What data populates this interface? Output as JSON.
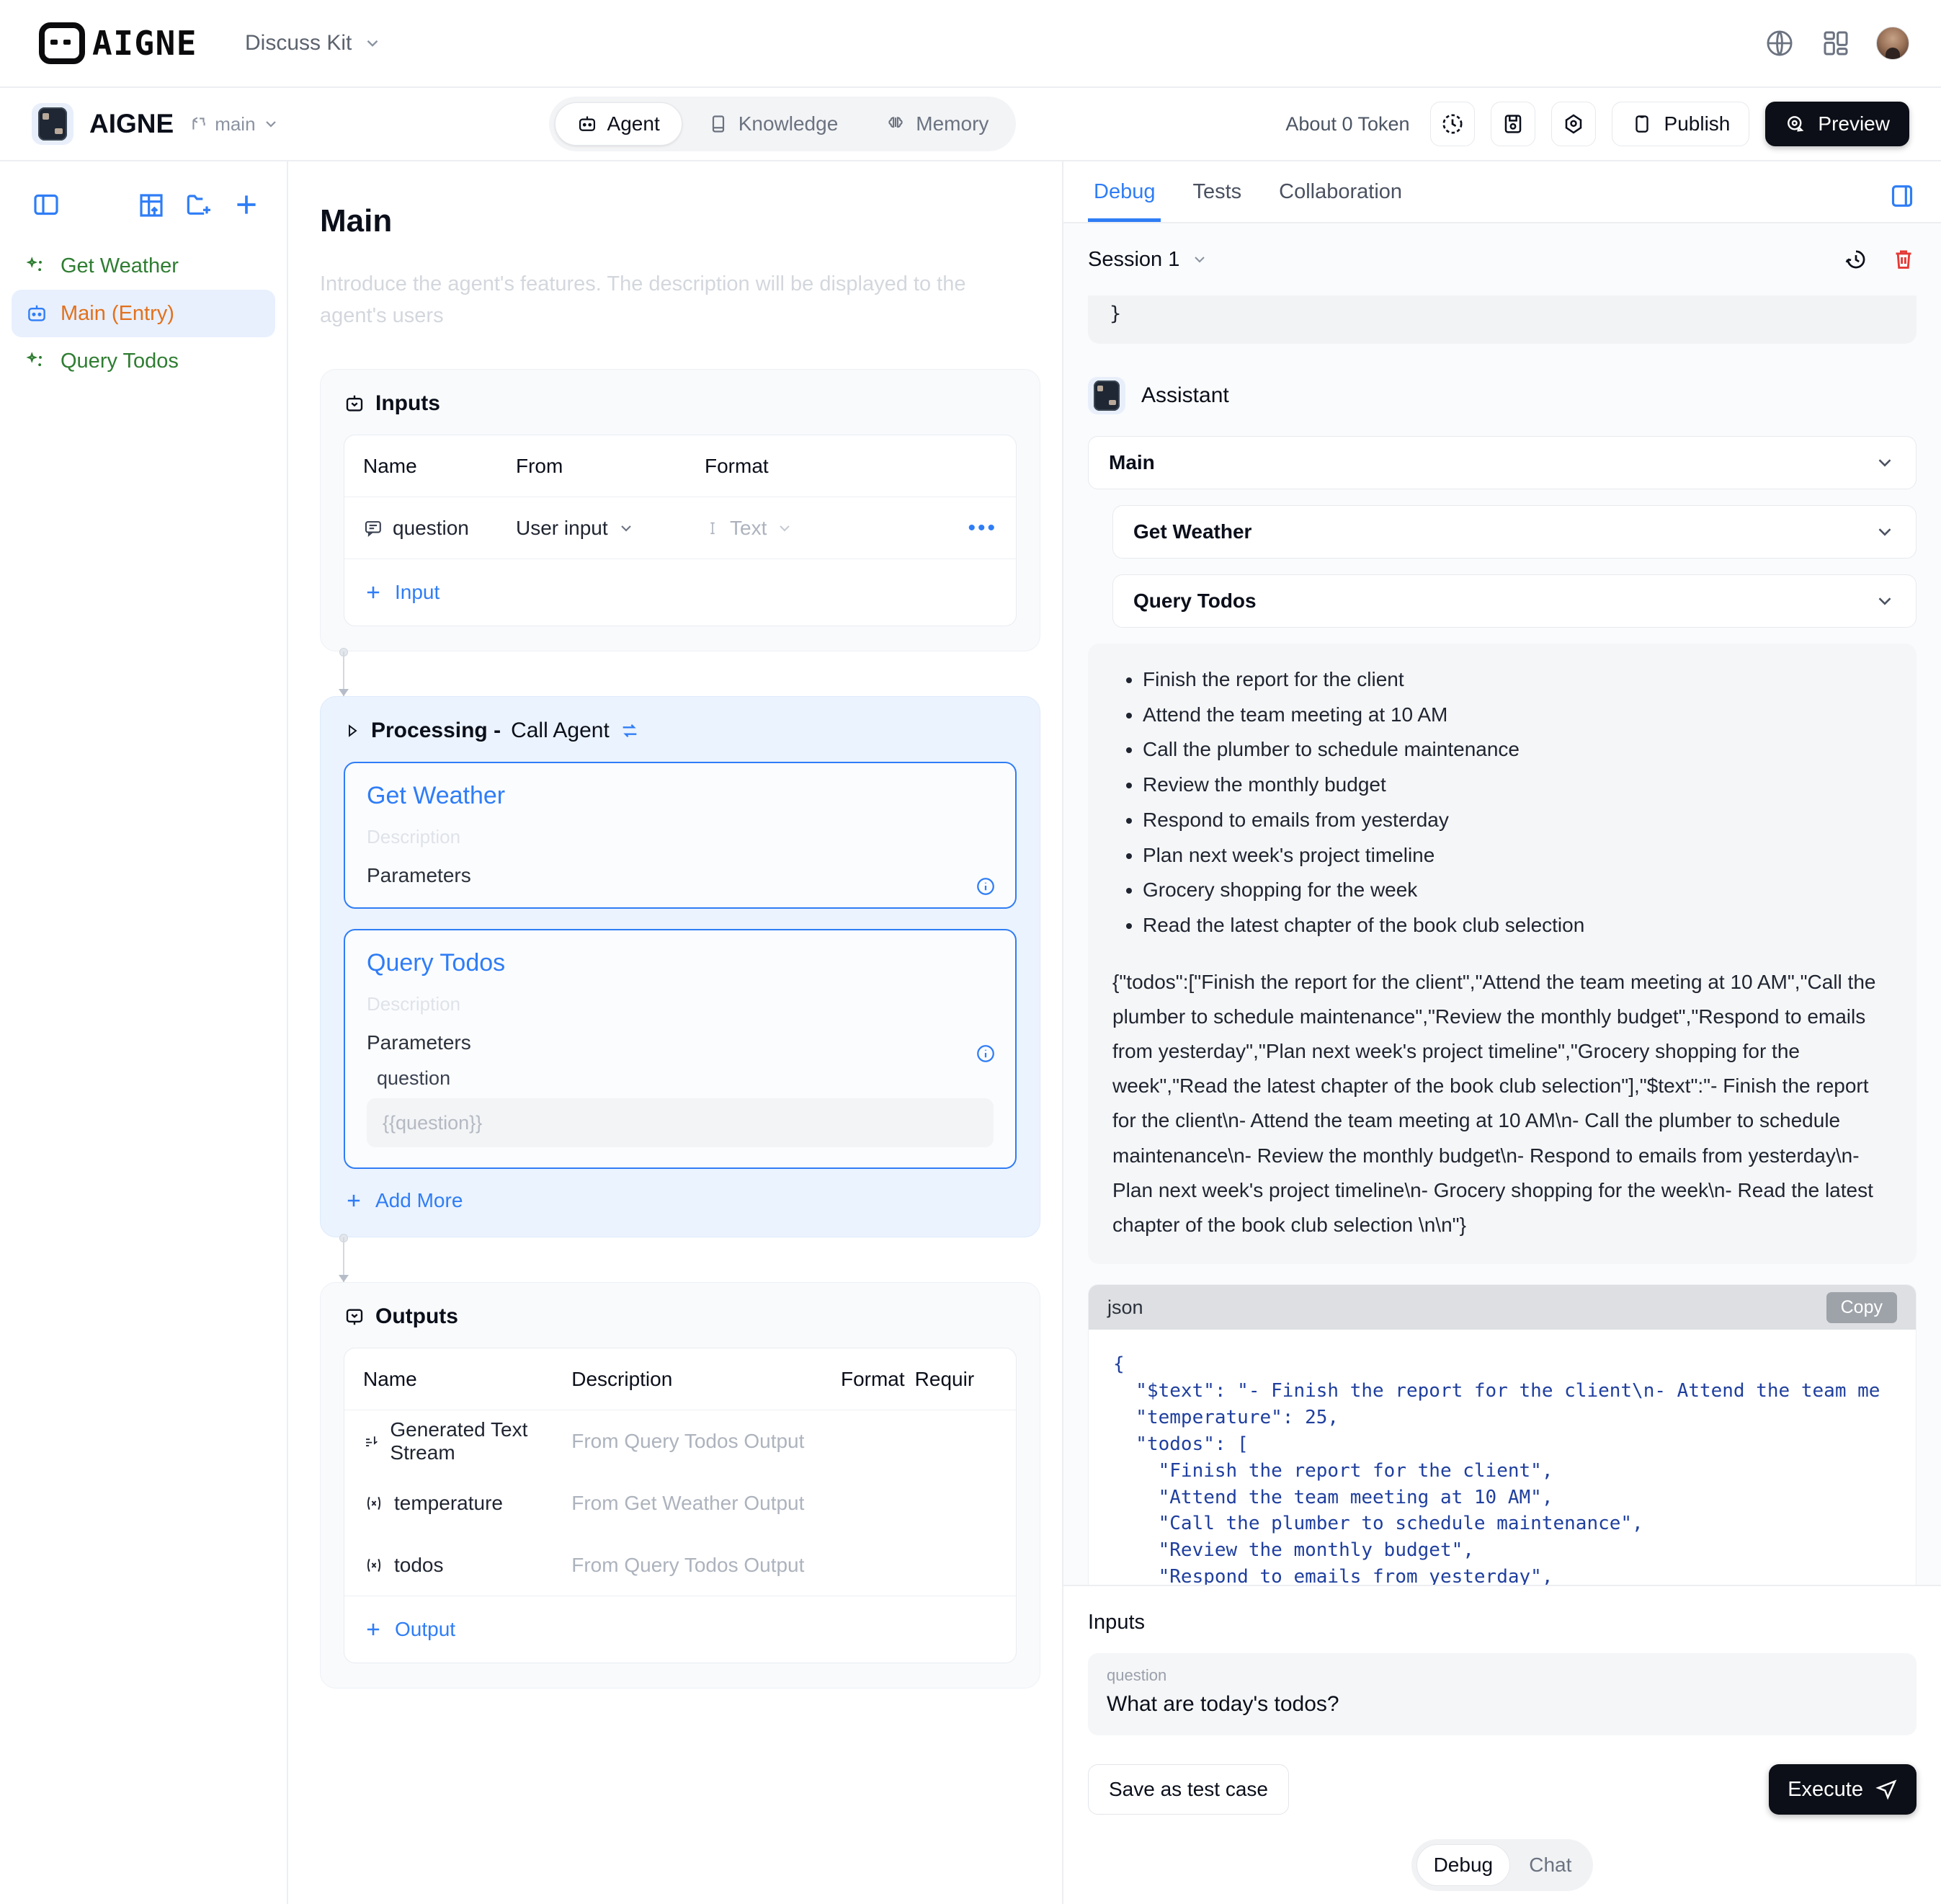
{
  "topbar": {
    "brand": "AIGNE",
    "kit_label": "Discuss Kit",
    "icons": {
      "globe": "globe-icon",
      "grid": "apps-grid-icon",
      "avatar": "user-avatar"
    }
  },
  "subbar": {
    "project_name": "AIGNE",
    "branch": "main",
    "tabs": [
      {
        "label": "Agent",
        "active": true
      },
      {
        "label": "Knowledge",
        "active": false
      },
      {
        "label": "Memory",
        "active": false
      }
    ],
    "token_text": "About 0 Token",
    "publish_label": "Publish",
    "preview_label": "Preview"
  },
  "sidebar": {
    "items": [
      {
        "label": "Get Weather",
        "state": "normal"
      },
      {
        "label": "Main (Entry)",
        "state": "active"
      },
      {
        "label": "Query Todos",
        "state": "normal"
      }
    ]
  },
  "main": {
    "title": "Main",
    "description_placeholder": "Introduce the agent's features. The description will be displayed to the agent's users",
    "inputs": {
      "section_label": "Inputs",
      "columns": {
        "name": "Name",
        "from": "From",
        "format": "Format"
      },
      "rows": [
        {
          "name": "question",
          "from": "User input",
          "format": "Text"
        }
      ],
      "add_label": "Input"
    },
    "processing": {
      "section_label": "Processing - ",
      "kind_label": "Call Agent",
      "agents": [
        {
          "title": "Get Weather",
          "description_placeholder": "Description",
          "params_label": "Parameters",
          "params": []
        },
        {
          "title": "Query Todos",
          "description_placeholder": "Description",
          "params_label": "Parameters",
          "params": [
            {
              "label": "question",
              "placeholder": "{{question}}"
            }
          ]
        }
      ],
      "add_more_label": "Add More"
    },
    "outputs": {
      "section_label": "Outputs",
      "columns": {
        "name": "Name",
        "description": "Description",
        "format": "Format",
        "required": "Requir"
      },
      "rows": [
        {
          "name": "Generated Text Stream",
          "description": "From Query Todos Output",
          "icon": "stream-icon"
        },
        {
          "name": "temperature",
          "description": "From Get Weather Output",
          "icon": "variable-icon"
        },
        {
          "name": "todos",
          "description": "From Query Todos Output",
          "icon": "variable-icon"
        }
      ],
      "add_label": "Output"
    }
  },
  "rightpanel": {
    "tabs": [
      {
        "label": "Debug",
        "active": true
      },
      {
        "label": "Tests",
        "active": false
      },
      {
        "label": "Collaboration",
        "active": false
      }
    ],
    "session": "Session 1",
    "prev_message_fragment": "}",
    "assistant_label": "Assistant",
    "accordions": [
      {
        "label": "Main",
        "nested": false
      },
      {
        "label": "Get Weather",
        "nested": true
      },
      {
        "label": "Query Todos",
        "nested": true
      }
    ],
    "todo_list": [
      "Finish the report for the client",
      "Attend the team meeting at 10 AM",
      "Call the plumber to schedule maintenance",
      "Review the monthly budget",
      "Respond to emails from yesterday",
      "Plan next week's project timeline",
      "Grocery shopping for the week",
      "Read the latest chapter of the book club selection"
    ],
    "raw_json_paragraph": "{\"todos\":[\"Finish the report for the client\",\"Attend the team meeting at 10 AM\",\"Call the plumber to schedule maintenance\",\"Review the monthly budget\",\"Respond to emails from yesterday\",\"Plan next week's project timeline\",\"Grocery shopping for the week\",\"Read the latest chapter of the book club selection\"],\"$text\":\"- Finish the report for the client\\n- Attend the team meeting at 10 AM\\n- Call the plumber to schedule maintenance\\n- Review the monthly budget\\n- Respond to emails from yesterday\\n- Plan next week's project timeline\\n- Grocery shopping for the week\\n- Read the latest chapter of the book club selection \\n\\n\"}",
    "code_block": {
      "language": "json",
      "copy_label": "Copy",
      "content": "{\n  \"$text\": \"- Finish the report for the client\\n- Attend the team me\n  \"temperature\": 25,\n  \"todos\": [\n    \"Finish the report for the client\",\n    \"Attend the team meeting at 10 AM\",\n    \"Call the plumber to schedule maintenance\",\n    \"Review the monthly budget\",\n    \"Respond to emails from yesterday\",\n    \"Plan next week's project timeline\",\n    \"Grocery shopping for the week\",\n    \"Read the latest chapter of the book club selection\"\n  ]\n}"
    },
    "footer": {
      "inputs_title": "Inputs",
      "field_label": "question",
      "field_value": "What are today's todos?",
      "save_label": "Save as test case",
      "execute_label": "Execute",
      "modes": [
        {
          "label": "Debug",
          "active": true
        },
        {
          "label": "Chat",
          "active": false
        }
      ]
    }
  },
  "colors": {
    "accent": "#2f7df6",
    "active_nav": "#e2711d",
    "agent_green": "#2f7d32",
    "dark": "#0c0f17",
    "danger": "#e53935"
  }
}
